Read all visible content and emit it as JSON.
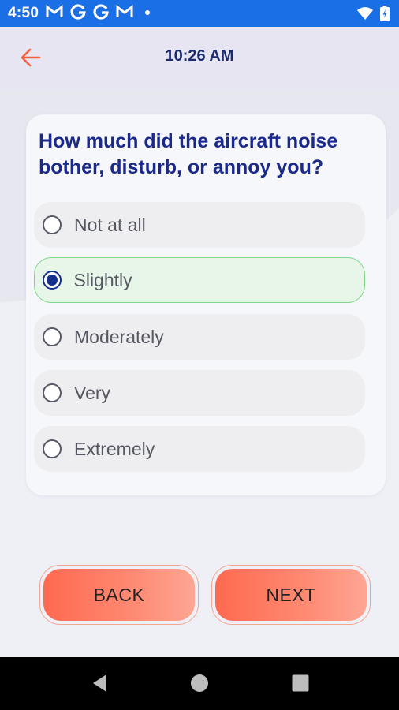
{
  "status_bar": {
    "time": "4:50",
    "notifications": [
      "gmail-icon",
      "google-icon",
      "google-icon",
      "gmail-icon"
    ],
    "color": "#1a6ee6"
  },
  "header": {
    "title": "10:26 AM",
    "accent": "#f4603e"
  },
  "question": {
    "text": "How much did the aircraft noise bother, disturb, or annoy you?",
    "options": [
      {
        "label": "Not at all",
        "selected": false
      },
      {
        "label": "Slightly",
        "selected": true
      },
      {
        "label": "Moderately",
        "selected": false
      },
      {
        "label": "Very",
        "selected": false
      },
      {
        "label": "Extremely",
        "selected": false
      }
    ]
  },
  "buttons": {
    "back_label": "BACK",
    "next_label": "NEXT"
  },
  "colors": {
    "title": "#1b2a8a",
    "selected_border": "#7fd689",
    "selected_bg": "#e7f6e9",
    "button_gradient_start": "#fe6a50",
    "button_gradient_end": "#fda694"
  }
}
